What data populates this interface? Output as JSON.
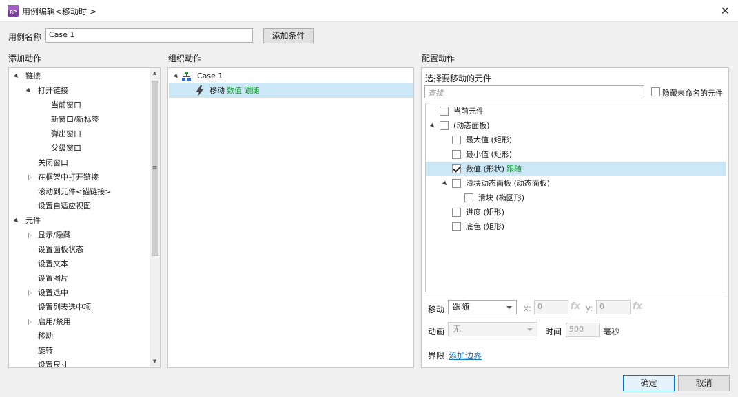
{
  "window": {
    "title": "用例编辑<移动时 >",
    "app_icon_text": "RP",
    "close_glyph": "✕"
  },
  "case_name": {
    "label": "用例名称",
    "value": "Case 1",
    "add_condition_button": "添加条件"
  },
  "sections": {
    "add_actions": "添加动作",
    "organize_actions": "组织动作",
    "configure_actions": "配置动作"
  },
  "add_actions_tree": [
    {
      "label": "链接",
      "level": 0,
      "state": "open"
    },
    {
      "label": "打开链接",
      "level": 1,
      "state": "open"
    },
    {
      "label": "当前窗口",
      "level": 2,
      "state": "leaf"
    },
    {
      "label": "新窗口/新标签",
      "level": 2,
      "state": "leaf"
    },
    {
      "label": "弹出窗口",
      "level": 2,
      "state": "leaf"
    },
    {
      "label": "父级窗口",
      "level": 2,
      "state": "leaf"
    },
    {
      "label": "关闭窗口",
      "level": 1,
      "state": "leaf"
    },
    {
      "label": "在框架中打开链接",
      "level": 1,
      "state": "closed"
    },
    {
      "label": "滚动到元件<锚链接>",
      "level": 1,
      "state": "leaf"
    },
    {
      "label": "设置自适应视图",
      "level": 1,
      "state": "leaf"
    },
    {
      "label": "元件",
      "level": 0,
      "state": "open"
    },
    {
      "label": "显示/隐藏",
      "level": 1,
      "state": "closed"
    },
    {
      "label": "设置面板状态",
      "level": 1,
      "state": "leaf"
    },
    {
      "label": "设置文本",
      "level": 1,
      "state": "leaf"
    },
    {
      "label": "设置图片",
      "level": 1,
      "state": "leaf"
    },
    {
      "label": "设置选中",
      "level": 1,
      "state": "closed"
    },
    {
      "label": "设置列表选中项",
      "level": 1,
      "state": "leaf"
    },
    {
      "label": "启用/禁用",
      "level": 1,
      "state": "closed"
    },
    {
      "label": "移动",
      "level": 1,
      "state": "leaf"
    },
    {
      "label": "旋转",
      "level": 1,
      "state": "leaf"
    },
    {
      "label": "设置尺寸",
      "level": 1,
      "state": "leaf"
    }
  ],
  "organize": {
    "case_label": "Case 1",
    "action_prefix": "移动",
    "action_target": "数值 跟随"
  },
  "configure": {
    "select_label": "选择要移动的元件",
    "search_placeholder": "查找",
    "hide_unnamed_label": "隐藏未命名的元件",
    "widgets": [
      {
        "label": "当前元件",
        "level": 0,
        "checked": false,
        "expand": "none",
        "suffix": ""
      },
      {
        "label": "(动态面板)",
        "level": 0,
        "checked": false,
        "expand": "open",
        "suffix": ""
      },
      {
        "label": "最大值 (矩形)",
        "level": 1,
        "checked": false,
        "expand": "none",
        "suffix": ""
      },
      {
        "label": "最小值 (矩形)",
        "level": 1,
        "checked": false,
        "expand": "none",
        "suffix": ""
      },
      {
        "label": "数值 (形状)",
        "level": 1,
        "checked": true,
        "expand": "none",
        "suffix": "跟随"
      },
      {
        "label": "滑块动态面板 (动态面板)",
        "level": 1,
        "checked": false,
        "expand": "open",
        "suffix": ""
      },
      {
        "label": "滑块 (椭圆形)",
        "level": 2,
        "checked": false,
        "expand": "none",
        "suffix": ""
      },
      {
        "label": "进度 (矩形)",
        "level": 1,
        "checked": false,
        "expand": "none",
        "suffix": ""
      },
      {
        "label": "底色 (矩形)",
        "level": 1,
        "checked": false,
        "expand": "none",
        "suffix": ""
      }
    ],
    "move_label": "移动",
    "move_value": "跟随",
    "x_label": "x:",
    "x_value": "0",
    "y_label": "y:",
    "y_value": "0",
    "fx_label": "fx",
    "animation_label": "动画",
    "animation_value": "无",
    "time_label": "时间",
    "time_value": "500",
    "ms_label": "毫秒",
    "bounds_label": "界限",
    "add_bounds_link": "添加边界"
  },
  "footer": {
    "ok": "确定",
    "cancel": "取消"
  },
  "colors": {
    "selection": "#cce8f6",
    "follow_text": "#1a9a3a",
    "link": "#1a73c8",
    "app_icon": "#7b3fa0"
  }
}
